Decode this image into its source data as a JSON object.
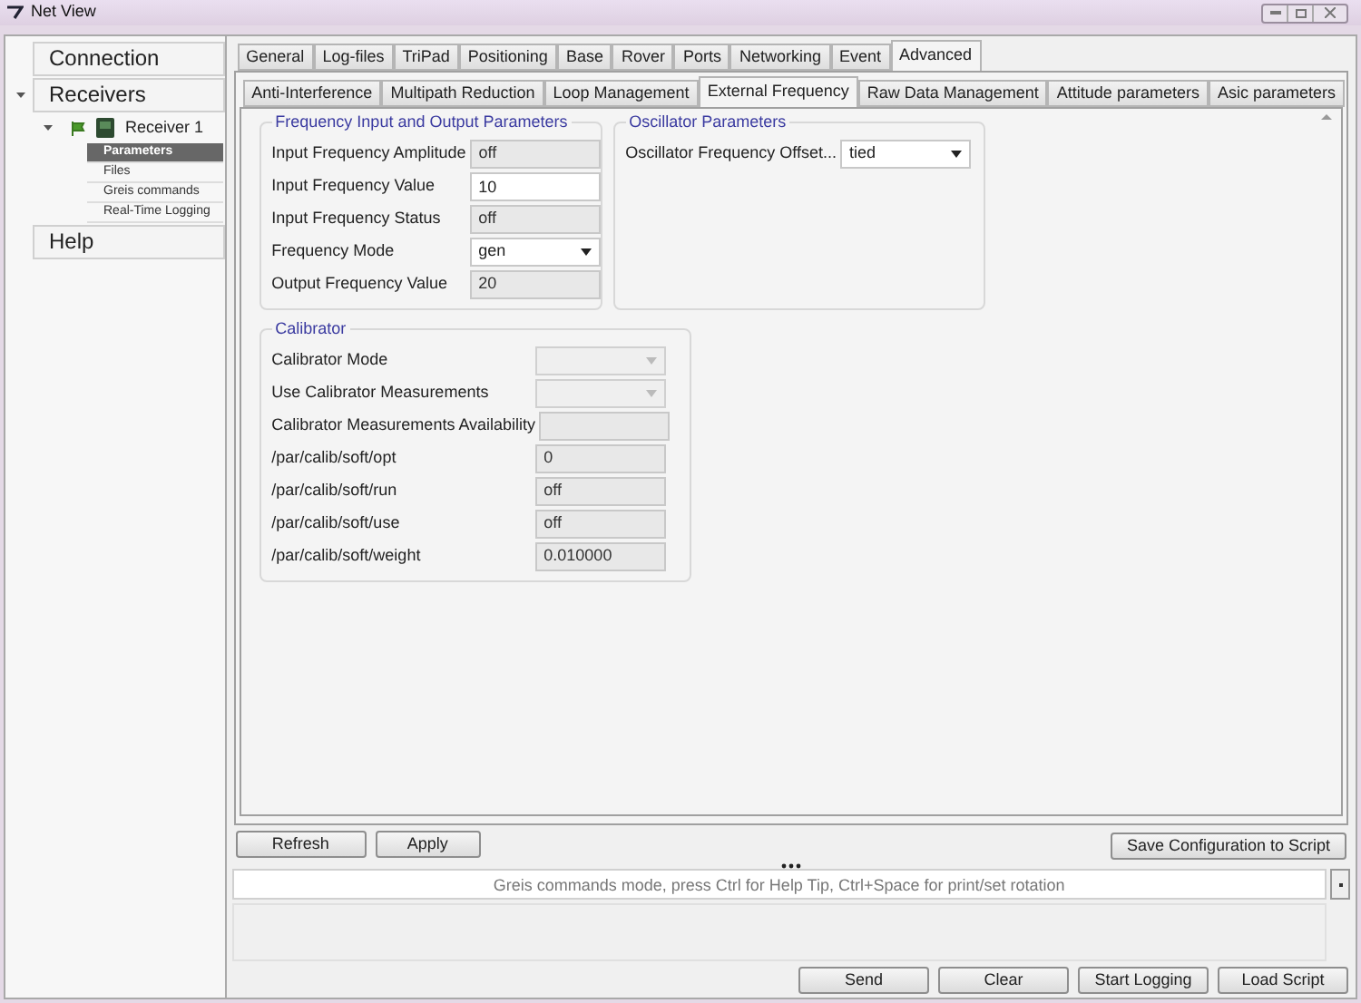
{
  "window": {
    "title": "Net View"
  },
  "sidebar": {
    "items": [
      {
        "label": "Connection"
      },
      {
        "label": "Receivers",
        "expanded": true,
        "children": [
          {
            "label": "Receiver 1",
            "expanded": true,
            "children": [
              {
                "label": "Parameters",
                "selected": true
              },
              {
                "label": "Files",
                "selected": false
              },
              {
                "label": "Greis commands",
                "selected": false
              },
              {
                "label": "Real-Time Logging",
                "selected": false
              }
            ]
          }
        ]
      },
      {
        "label": "Help"
      }
    ]
  },
  "tabs": [
    {
      "label": "General",
      "selected": false
    },
    {
      "label": "Log-files",
      "selected": false
    },
    {
      "label": "TriPad",
      "selected": false
    },
    {
      "label": "Positioning",
      "selected": false
    },
    {
      "label": "Base",
      "selected": false
    },
    {
      "label": "Rover",
      "selected": false
    },
    {
      "label": "Ports",
      "selected": false
    },
    {
      "label": "Networking",
      "selected": false
    },
    {
      "label": "Event",
      "selected": false
    },
    {
      "label": "Advanced",
      "selected": true
    }
  ],
  "subtabs": [
    {
      "label": "Anti-Interference",
      "selected": false
    },
    {
      "label": "Multipath Reduction",
      "selected": false
    },
    {
      "label": "Loop Management",
      "selected": false
    },
    {
      "label": "External Frequency",
      "selected": true
    },
    {
      "label": "Raw Data Management",
      "selected": false
    },
    {
      "label": "Attitude parameters",
      "selected": false
    },
    {
      "label": "Asic parameters",
      "selected": false
    }
  ],
  "groups": [
    {
      "title": "Frequency Input and Output Parameters",
      "rows": [
        {
          "label": "Input Frequency Amplitude",
          "kind": "readonly",
          "value": "off"
        },
        {
          "label": "Input Frequency Value",
          "kind": "input",
          "value": "10"
        },
        {
          "label": "Input Frequency Status",
          "kind": "readonly",
          "value": "off"
        },
        {
          "label": "Frequency Mode",
          "kind": "dropdown",
          "value": "gen",
          "disabled": false
        },
        {
          "label": "Output Frequency Value",
          "kind": "readonly",
          "value": "20"
        }
      ]
    },
    {
      "title": "Oscillator Parameters",
      "rows": [
        {
          "label": "Oscillator Frequency Offset...",
          "kind": "dropdown",
          "value": "tied",
          "disabled": false
        }
      ]
    },
    {
      "title": "Calibrator",
      "rows": [
        {
          "label": "Calibrator Mode",
          "kind": "dropdown",
          "disabled": true
        },
        {
          "label": "Use Calibrator Measurements",
          "kind": "dropdown",
          "disabled": true
        },
        {
          "label": "Calibrator Measurements Availability",
          "kind": "readonly"
        },
        {
          "label": "/par/calib/soft/opt",
          "kind": "readonly",
          "value": "0"
        },
        {
          "label": "/par/calib/soft/run",
          "kind": "readonly",
          "value": "off"
        },
        {
          "label": "/par/calib/soft/use",
          "kind": "readonly",
          "value": "off"
        },
        {
          "label": "/par/calib/soft/weight",
          "kind": "readonly",
          "value": "0.010000"
        }
      ]
    }
  ],
  "actions": {
    "left": [
      "Refresh",
      "Apply"
    ],
    "right": "Save Configuration to Script"
  },
  "console": {
    "placeholder": "Greis commands mode, press Ctrl for Help Tip, Ctrl+Space for print/set rotation"
  },
  "bottom_buttons": [
    "Send",
    "Clear",
    "Start Logging",
    "Load Script"
  ]
}
